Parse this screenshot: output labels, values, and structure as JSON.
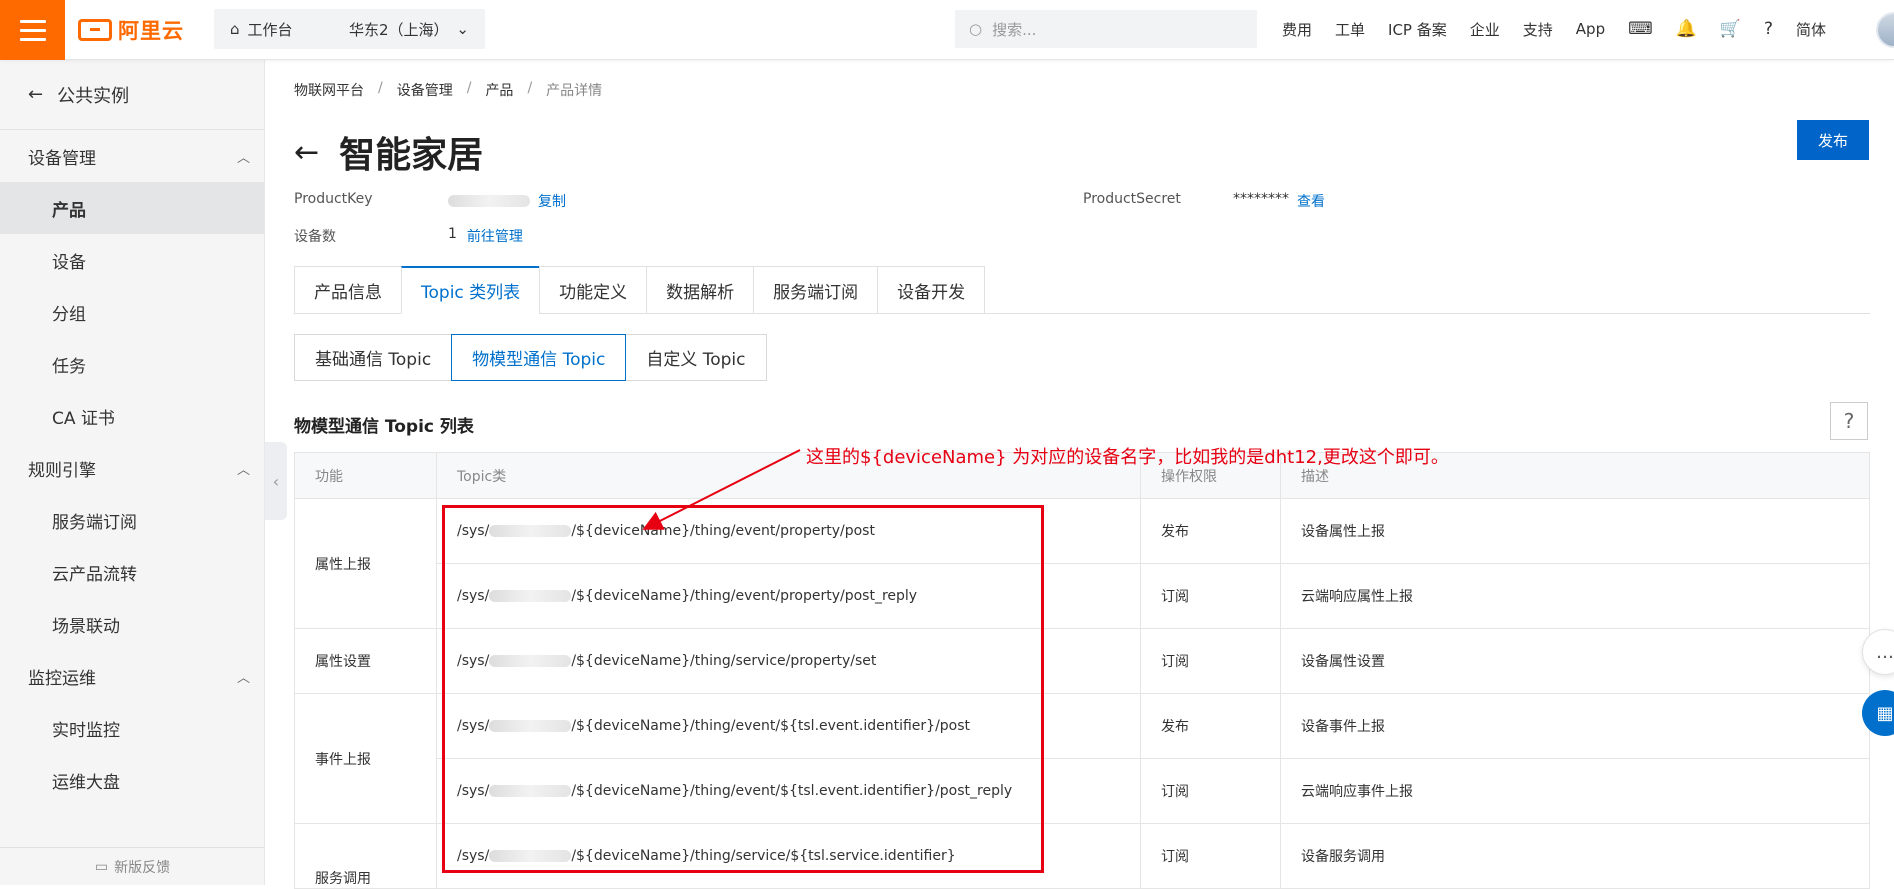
{
  "header": {
    "logo_text": "阿里云",
    "workbench": "工作台",
    "region": "华东2（上海）",
    "search_placeholder": "搜索...",
    "nav": [
      "费用",
      "工单",
      "ICP 备案",
      "企业",
      "支持",
      "App"
    ],
    "lang": "简体"
  },
  "sidebar": {
    "back_label": "公共实例",
    "groups": [
      {
        "label": "设备管理",
        "items": [
          "产品",
          "设备",
          "分组",
          "任务",
          "CA 证书"
        ]
      },
      {
        "label": "规则引擎",
        "items": [
          "服务端订阅",
          "云产品流转",
          "场景联动"
        ]
      },
      {
        "label": "监控运维",
        "items": [
          "实时监控",
          "运维大盘"
        ]
      }
    ],
    "active_item": "产品",
    "feedback": "新版反馈"
  },
  "breadcrumb": [
    "物联网平台",
    "设备管理",
    "产品",
    "产品详情"
  ],
  "page": {
    "title": "智能家居",
    "publish": "发布",
    "product_key_label": "ProductKey",
    "copy": "复制",
    "product_secret_label": "ProductSecret",
    "product_secret_value": "********",
    "view": "查看",
    "device_count_label": "设备数",
    "device_count": "1",
    "manage_link": "前往管理"
  },
  "tabs": [
    "产品信息",
    "Topic 类列表",
    "功能定义",
    "数据解析",
    "服务端订阅",
    "设备开发"
  ],
  "active_tab": "Topic 类列表",
  "subtabs": [
    "基础通信 Topic",
    "物模型通信 Topic",
    "自定义 Topic"
  ],
  "active_subtab": "物模型通信 Topic",
  "section_title": "物模型通信 Topic 列表",
  "help": "?",
  "table": {
    "headers": [
      "功能",
      "Topic类",
      "操作权限",
      "描述"
    ],
    "rows": [
      {
        "func": "属性上报",
        "topic_prefix": "/sys/",
        "topic": "/${deviceName}/thing/event/property/post",
        "perm": "发布",
        "desc": "设备属性上报"
      },
      {
        "func": "",
        "topic_prefix": "/sys/",
        "topic": "/${deviceName}/thing/event/property/post_reply",
        "perm": "订阅",
        "desc": "云端响应属性上报"
      },
      {
        "func": "属性设置",
        "topic_prefix": "/sys/",
        "topic": "/${deviceName}/thing/service/property/set",
        "perm": "订阅",
        "desc": "设备属性设置"
      },
      {
        "func": "事件上报",
        "topic_prefix": "/sys/",
        "topic": "/${deviceName}/thing/event/${tsl.event.identifier}/post",
        "perm": "发布",
        "desc": "设备事件上报"
      },
      {
        "func": "",
        "topic_prefix": "/sys/",
        "topic": "/${deviceName}/thing/event/${tsl.event.identifier}/post_reply",
        "perm": "订阅",
        "desc": "云端响应事件上报"
      },
      {
        "func": "服务调用",
        "topic_prefix": "/sys/",
        "topic": "/${deviceName}/thing/service/${tsl.service.identifier}",
        "perm": "订阅",
        "desc": "设备服务调用"
      }
    ]
  },
  "annotation": "这里的${deviceName} 为对应的设备名字，比如我的是dht12,更改这个即可。",
  "colors": {
    "brand": "#ff6a00",
    "primary": "#0070cc",
    "annotation": "#e60012"
  }
}
